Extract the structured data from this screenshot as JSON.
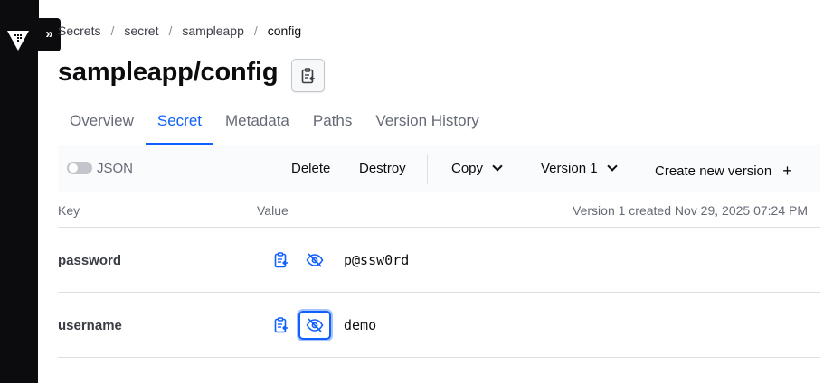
{
  "breadcrumb": [
    {
      "label": "Secrets"
    },
    {
      "label": "secret"
    },
    {
      "label": "sampleapp"
    },
    {
      "label": "config"
    }
  ],
  "page": {
    "title": "sampleapp/config"
  },
  "tabs": [
    {
      "label": "Overview"
    },
    {
      "label": "Secret"
    },
    {
      "label": "Metadata"
    },
    {
      "label": "Paths"
    },
    {
      "label": "Version History"
    }
  ],
  "toolbar": {
    "json_toggle_label": "JSON",
    "delete_label": "Delete",
    "destroy_label": "Destroy",
    "copy_label": "Copy",
    "version_label": "Version 1",
    "create_label": "Create new version"
  },
  "table": {
    "col_key": "Key",
    "col_value": "Value",
    "meta": "Version 1 created Nov 29, 2025 07:24 PM",
    "rows": [
      {
        "key": "password",
        "value": "p@ssw0rd"
      },
      {
        "key": "username",
        "value": "demo"
      }
    ]
  },
  "colors": {
    "accent": "#1060ff",
    "sidebar": "#0c0c0e"
  }
}
